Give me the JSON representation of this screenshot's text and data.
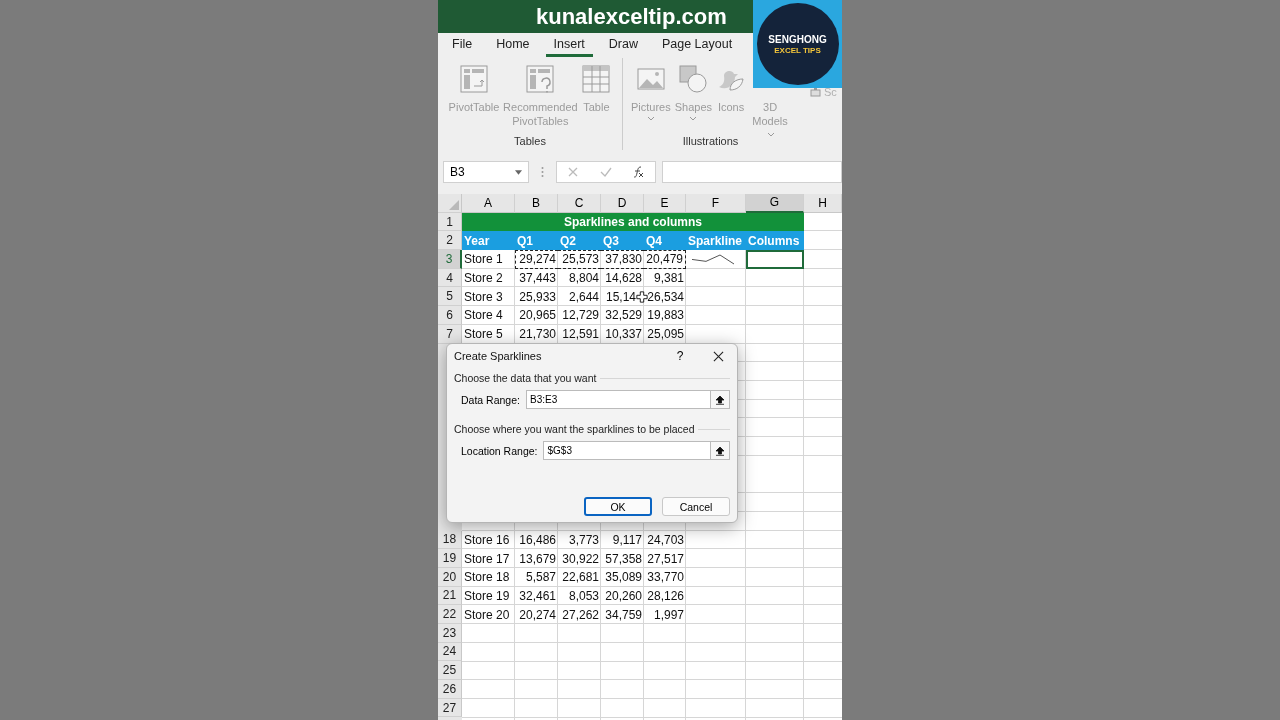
{
  "banner": {
    "text": "kunalexceltip.com"
  },
  "logo": {
    "title": "SENGHONG",
    "subtitle": "EXCEL TIPS"
  },
  "ribbon_tabs": [
    {
      "label": "File",
      "selected": false
    },
    {
      "label": "Home",
      "selected": false
    },
    {
      "label": "Insert",
      "selected": true
    },
    {
      "label": "Draw",
      "selected": false
    },
    {
      "label": "Page Layout",
      "selected": false
    }
  ],
  "ribbon_groups": [
    {
      "label": "Tables",
      "buttons": [
        {
          "label": "PivotTable",
          "kind": "pivot",
          "dropdown": false
        },
        {
          "label": "Recommended PivotTables",
          "kind": "recpivot",
          "dropdown": false
        },
        {
          "label": "Table",
          "kind": "table",
          "dropdown": false
        }
      ]
    },
    {
      "label": "Illustrations",
      "buttons": [
        {
          "label": "Pictures",
          "kind": "pictures",
          "dropdown": true
        },
        {
          "label": "Shapes",
          "kind": "shapes",
          "dropdown": true
        },
        {
          "label": "Icons",
          "kind": "icons",
          "dropdown": false
        },
        {
          "label": "3D Models",
          "kind": "models",
          "dropdown": true
        }
      ]
    }
  ],
  "ribbon_cut_label": "Sc",
  "formula_bar": {
    "name_box": "B3"
  },
  "columns": [
    {
      "label": "A",
      "selected": false
    },
    {
      "label": "B",
      "selected": false
    },
    {
      "label": "C",
      "selected": false
    },
    {
      "label": "D",
      "selected": false
    },
    {
      "label": "E",
      "selected": false
    },
    {
      "label": "F",
      "selected": false
    },
    {
      "label": "G",
      "selected": true
    },
    {
      "label": "H",
      "selected": false
    }
  ],
  "title_row": {
    "row": "1",
    "text": "Sparklines and columns"
  },
  "header_row": {
    "row": "2",
    "cells": [
      "Year",
      "Q1",
      "Q2",
      "Q3",
      "Q4",
      "Sparkline",
      "Columns"
    ]
  },
  "rows_top": [
    {
      "row": "3",
      "selected": true,
      "copied": true,
      "sparkline": true,
      "cursor": false,
      "cells": [
        "Store 1",
        "29,274",
        "25,573",
        "37,830",
        "20,479"
      ]
    },
    {
      "row": "4",
      "selected": false,
      "copied": false,
      "sparkline": false,
      "cursor": false,
      "cells": [
        "Store 2",
        "37,443",
        "8,804",
        "14,628",
        "9,381"
      ]
    },
    {
      "row": "5",
      "selected": false,
      "copied": false,
      "sparkline": false,
      "cursor": true,
      "cells": [
        "Store 3",
        "25,933",
        "2,644",
        "15,14",
        "26,534"
      ]
    },
    {
      "row": "6",
      "selected": false,
      "copied": false,
      "sparkline": false,
      "cursor": false,
      "cells": [
        "Store 4",
        "20,965",
        "12,729",
        "32,529",
        "19,883"
      ]
    },
    {
      "row": "7",
      "selected": false,
      "copied": false,
      "sparkline": false,
      "cursor": false,
      "cells": [
        "Store 5",
        "21,730",
        "12,591",
        "10,337",
        "25,095"
      ]
    }
  ],
  "rows_bottom": [
    {
      "row": "18",
      "cells": [
        "Store 16",
        "16,486",
        "3,773",
        "9,117",
        "24,703"
      ]
    },
    {
      "row": "19",
      "cells": [
        "Store 17",
        "13,679",
        "30,922",
        "57,358",
        "27,517"
      ]
    },
    {
      "row": "20",
      "cells": [
        "Store 18",
        "5,587",
        "22,681",
        "35,089",
        "33,770"
      ]
    },
    {
      "row": "21",
      "cells": [
        "Store 19",
        "32,461",
        "8,053",
        "20,260",
        "28,126"
      ]
    },
    {
      "row": "22",
      "cells": [
        "Store 20",
        "20,274",
        "27,262",
        "34,759",
        "1,997"
      ]
    },
    {
      "row": "23"
    },
    {
      "row": "24"
    },
    {
      "row": "25"
    },
    {
      "row": "26"
    },
    {
      "row": "27"
    }
  ],
  "dialog": {
    "title": "Create Sparklines",
    "help": "?",
    "sections": [
      {
        "heading": "Choose the data that you want",
        "label": "Data Range:",
        "value": "B3:E3"
      },
      {
        "heading": "Choose where you want the sparklines to be placed",
        "label": "Location Range:",
        "value": "$G$3"
      }
    ],
    "buttons": [
      {
        "label": "OK",
        "default": true
      },
      {
        "label": "Cancel",
        "default": false
      }
    ]
  }
}
